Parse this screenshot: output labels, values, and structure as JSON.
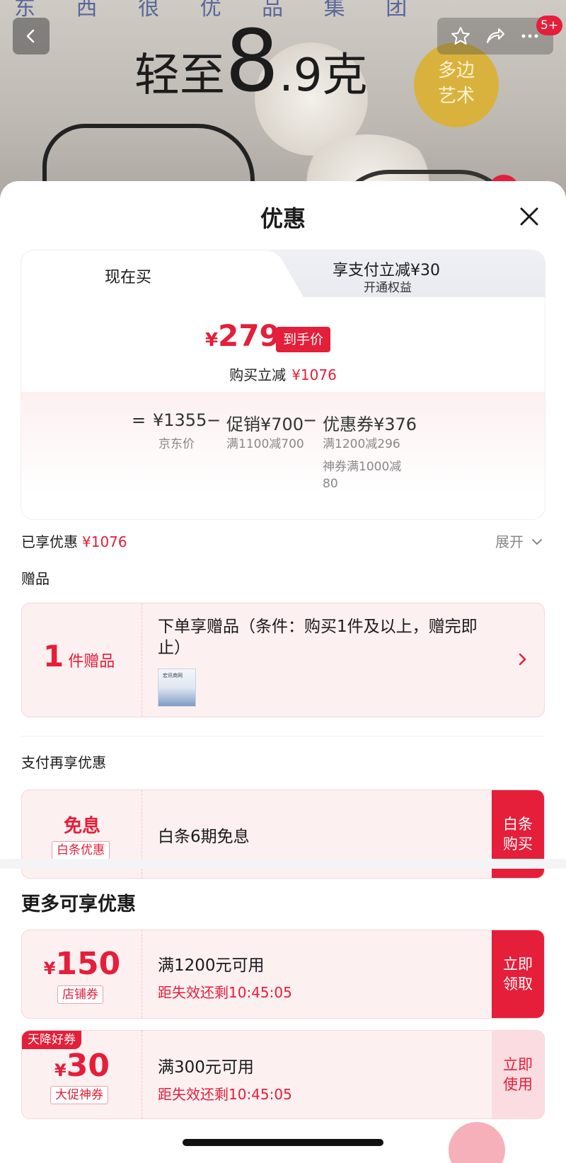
{
  "background": {
    "top_text": "东 西 很 优 品 集 团",
    "title_prefix": "轻至",
    "title_big": "8",
    "title_suffix": ".9克",
    "badge_text_1": "多边",
    "badge_text_2": "艺术",
    "notification_count": "5+"
  },
  "icons": {
    "back": "chevron-left-icon",
    "favorite": "star-icon",
    "share": "share-icon",
    "more": "more-icon",
    "close": "close-icon",
    "expand": "chevron-down-icon",
    "gift_arrow": "chevron-right-icon"
  },
  "sheet": {
    "title": "优惠"
  },
  "price_card": {
    "tab_now": "现在买",
    "tab_pay_title": "享支付立减¥30",
    "tab_pay_sub": "开通权益",
    "final_yen": "¥",
    "final_price": "279",
    "final_tag": "到手价",
    "reduce_label": "购买立减",
    "reduce_amount": "¥1076",
    "breakdown": {
      "equals": "=",
      "base_price": "¥1355",
      "base_label": "京东价",
      "minus1": "−",
      "promo": "促销¥700",
      "promo_detail": "满1100减700",
      "minus2": "−",
      "coupon": "优惠券¥376",
      "coupon_detail_1": "满1200减296",
      "coupon_detail_2a": "神券满1000减",
      "coupon_detail_2b": "80"
    }
  },
  "enjoyed": {
    "label": "已享优惠",
    "amount": "¥1076",
    "expand_label": "展开"
  },
  "gift": {
    "section_label": "赠品",
    "count": "1",
    "unit": "件赠品",
    "text": "下单享赠品（条件：购买1件及以上，赠完即止）",
    "thumb_text": "宏讯商网"
  },
  "pay": {
    "section_label": "支付再享优惠",
    "title": "免息",
    "tag": "白条优惠",
    "text": "白条6期免息",
    "action_1": "白条",
    "action_2": "购买"
  },
  "more": {
    "title": "更多可享优惠",
    "coupons": [
      {
        "yen": "¥",
        "value": "150",
        "tag": "店铺券",
        "condition": "满1200元可用",
        "countdown": "距失效还剩10:45:05",
        "action_1": "立即",
        "action_2": "领取",
        "ribbon": ""
      },
      {
        "yen": "¥",
        "value": "30",
        "tag": "大促神券",
        "condition": "满300元可用",
        "countdown": "距失效还剩10:45:05",
        "action_1": "立即",
        "action_2": "使用",
        "ribbon": "天降好券"
      }
    ]
  },
  "colors": {
    "accent": "#e51e3a",
    "card_bg": "#fdf0f1",
    "muted": "#888888"
  }
}
